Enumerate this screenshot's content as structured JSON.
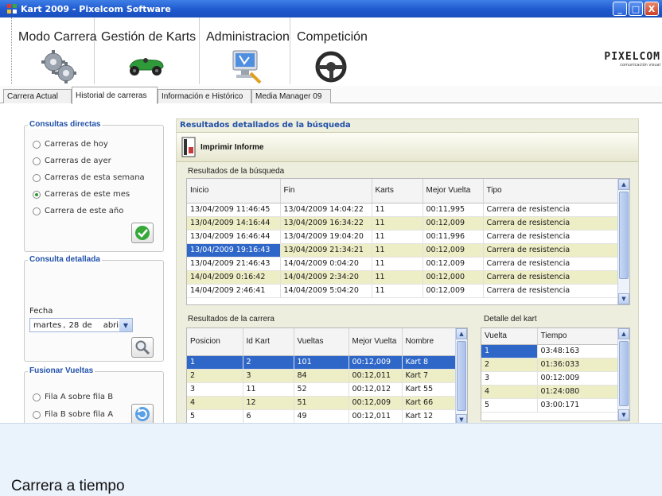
{
  "window": {
    "title": "Kart 2009 - Pixelcom Software",
    "buttons": [
      "_",
      "□",
      "X"
    ]
  },
  "menu": [
    {
      "label": "Modo Carrera",
      "icon": "gears-icon"
    },
    {
      "label": "Gestión de Karts",
      "icon": "kart-icon"
    },
    {
      "label": "Administracion",
      "icon": "admin-computer-icon"
    },
    {
      "label": "Competición",
      "icon": "steering-wheel-icon"
    }
  ],
  "logo": {
    "name": "PIXELCOM",
    "subtitle": "comunicación visual"
  },
  "tabs": [
    "Carrera Actual",
    "Historial de carreras",
    "Información e Histórico",
    "Media Manager 09"
  ],
  "active_tab": "Historial de carreras",
  "consultas_directas": {
    "title": "Consultas directas",
    "options": [
      {
        "label": "Carreras de hoy",
        "checked": false
      },
      {
        "label": "Carreras de ayer",
        "checked": false
      },
      {
        "label": "Carreras de esta semana",
        "checked": false
      },
      {
        "label": "Carreras de este mes",
        "checked": true
      },
      {
        "label": "Carrera de este año",
        "checked": false
      }
    ],
    "confirm_icon": "check-icon"
  },
  "consulta_detallada": {
    "title": "Consulta detallada",
    "fecha_label": "Fecha",
    "date": {
      "weekday": "martes",
      "day": "28",
      "sep": "de",
      "month": "abril"
    },
    "search_icon": "magnifier-icon"
  },
  "fusionar": {
    "title": "Fusionar Vueltas",
    "options": [
      "Fila A sobre fila B",
      "Fila B sobre fila A"
    ],
    "merge_icon": "refresh-icon"
  },
  "results": {
    "title": "Resultados detallados de la búsqueda",
    "print_label": "Imprimir Informe",
    "search_results_label": "Resultados de la búsqueda",
    "search_columns": [
      "Inicio",
      "Fin",
      "Karts",
      "Mejor Vuelta",
      "Tipo"
    ],
    "search_rows": [
      [
        "13/04/2009 11:46:45",
        "13/04/2009 14:04:22",
        "11",
        "00:11,995",
        "Carrera de resistencia"
      ],
      [
        "13/04/2009 14:16:44",
        "13/04/2009 16:34:22",
        "11",
        "00:12,009",
        "Carrera de resistencia"
      ],
      [
        "13/04/2009 16:46:44",
        "13/04/2009 19:04:20",
        "11",
        "00:11,996",
        "Carrera de resistencia"
      ],
      [
        "13/04/2009 19:16:43",
        "13/04/2009 21:34:21",
        "11",
        "00:12,009",
        "Carrera de resistencia"
      ],
      [
        "13/04/2009 21:46:43",
        "14/04/2009 0:04:20",
        "11",
        "00:12,009",
        "Carrera de resistencia"
      ],
      [
        "14/04/2009 0:16:42",
        "14/04/2009 2:34:20",
        "11",
        "00:12,000",
        "Carrera de resistencia"
      ],
      [
        "14/04/2009 2:46:41",
        "14/04/2009 5:04:20",
        "11",
        "00:12,009",
        "Carrera de resistencia"
      ]
    ],
    "race_results_label": "Resultados de la carrera",
    "race_columns": [
      "Posicion",
      "Id Kart",
      "Vueltas",
      "Mejor Vuelta",
      "Nombre"
    ],
    "race_rows": [
      [
        "1",
        "2",
        "101",
        "00:12,009",
        "Kart 8"
      ],
      [
        "2",
        "3",
        "84",
        "00:12,011",
        "Kart 7"
      ],
      [
        "3",
        "11",
        "52",
        "00:12,012",
        "Kart 55"
      ],
      [
        "4",
        "12",
        "51",
        "00:12,009",
        "Kart 66"
      ],
      [
        "5",
        "6",
        "49",
        "00:12,011",
        "Kart 12"
      ]
    ],
    "kart_detail_label": "Detalle del kart",
    "kart_columns": [
      "Vuelta",
      "Tiempo"
    ],
    "kart_rows": [
      [
        "1",
        "03:48:163"
      ],
      [
        "2",
        "01:36:033"
      ],
      [
        "3",
        "00:12:009"
      ],
      [
        "4",
        "01:24:080"
      ],
      [
        "5",
        "03:00:171"
      ]
    ]
  },
  "status_text": "Carrera a tiempo",
  "colors": {
    "title_bar": "#2358d0",
    "selection": "#2f67c9",
    "row_alt": "#ededc6",
    "panel": "#eeeede",
    "group_title": "#2050a8"
  }
}
